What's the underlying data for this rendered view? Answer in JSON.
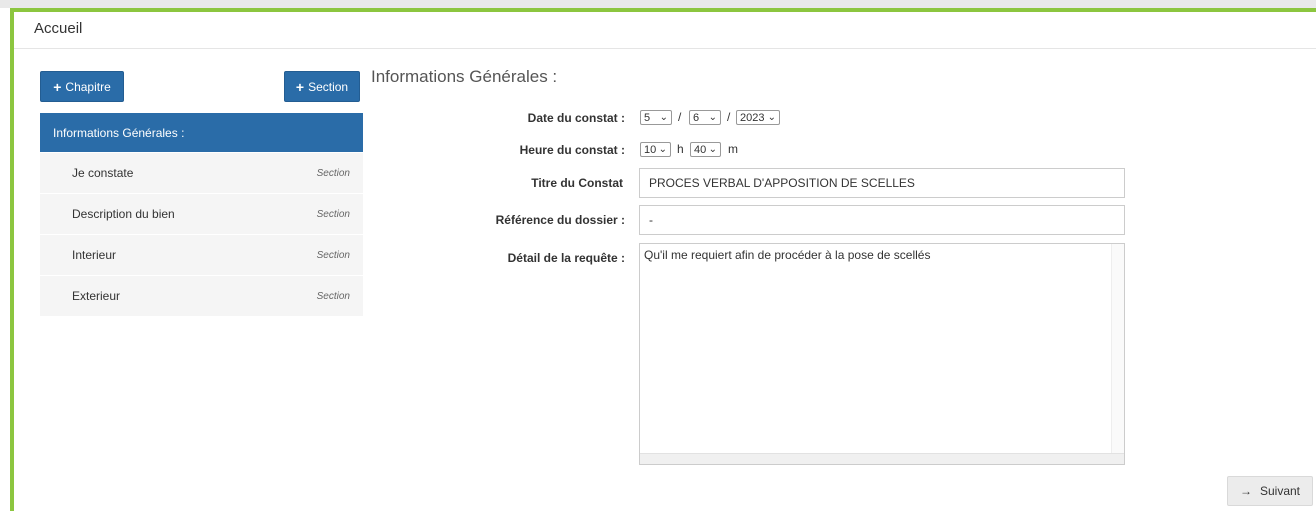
{
  "header": {
    "title": "Accueil"
  },
  "toolbar": {
    "add_chapter_label": "Chapitre",
    "add_section_label": "Section"
  },
  "sidebar": {
    "chapter": "Informations Générales :",
    "items": [
      {
        "label": "Je constate",
        "type": "Section"
      },
      {
        "label": "Description du bien",
        "type": "Section"
      },
      {
        "label": "Interieur",
        "type": "Section"
      },
      {
        "label": "Exterieur",
        "type": "Section"
      }
    ]
  },
  "main": {
    "title": "Informations Générales :",
    "date_label": "Date du constat :",
    "date_day": "5",
    "date_month": "6",
    "date_year": "2023",
    "date_sep": "/",
    "time_label": "Heure du constat :",
    "time_hour": "10",
    "time_hour_unit": "h",
    "time_minute": "40",
    "time_minute_unit": "m",
    "title_label": "Titre du Constat",
    "title_value": "PROCES VERBAL D'APPOSITION DE SCELLES",
    "ref_label": "Référence du dossier :",
    "ref_value": "-",
    "detail_label": "Détail de la requête :",
    "detail_value": "Qu'il me requiert afin de procéder à la pose de scellés"
  },
  "footer": {
    "next_label": "Suivant"
  }
}
